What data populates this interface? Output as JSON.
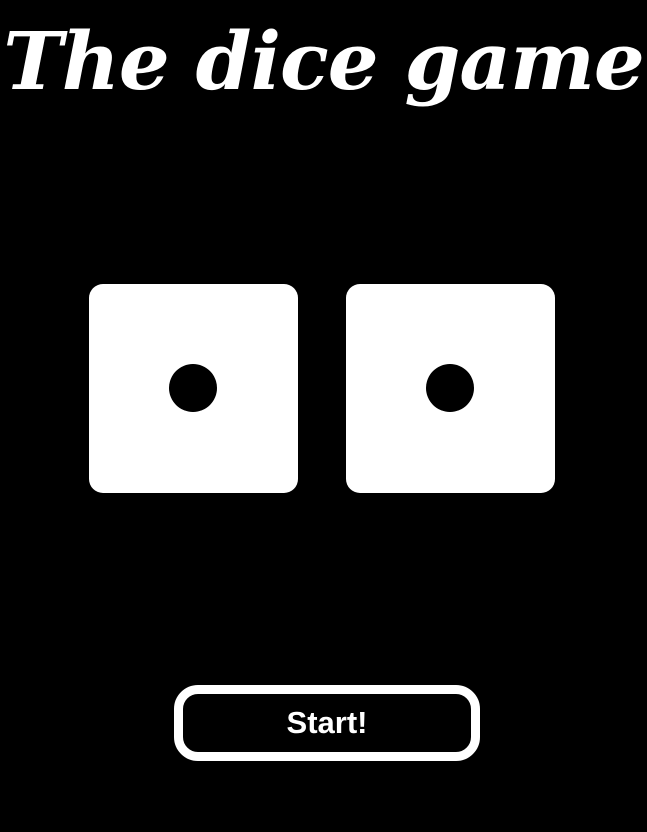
{
  "header": {
    "title": "The dice game"
  },
  "dice": [
    {
      "label": "die-left",
      "face_value": 1
    },
    {
      "label": "die-right",
      "face_value": 1
    }
  ],
  "controls": {
    "start_label": "Start!"
  },
  "colors": {
    "background": "#000000",
    "foreground": "#ffffff",
    "pip": "#000000"
  }
}
